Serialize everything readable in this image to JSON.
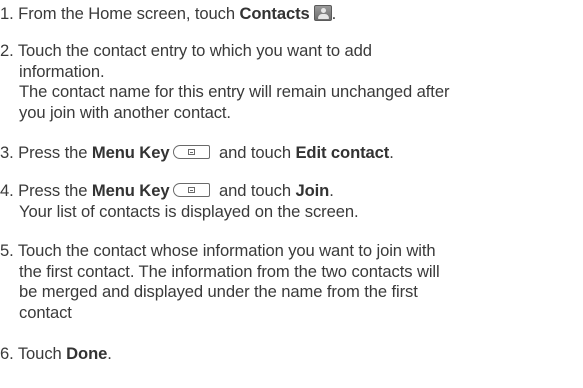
{
  "steps": [
    {
      "number": "1.",
      "line1_prefix": "From the Home screen, touch ",
      "line1_bold": "Contacts",
      "icon": "contacts-icon"
    },
    {
      "number": "2.",
      "line1": "Touch the contact entry to which you want to add",
      "line2": "information.",
      "line3": "The contact name for this entry will remain unchanged after",
      "line4": "you join with another contact."
    },
    {
      "number": "3.",
      "prefix": "Press the ",
      "bold1": "Menu Key",
      "icon": "menu-key-icon",
      "middle": " and touch ",
      "bold2": "Edit contact",
      "suffix": "."
    },
    {
      "number": "4.",
      "prefix": "Press the ",
      "bold1": "Menu Key",
      "icon": "menu-key-icon",
      "middle": " and touch ",
      "bold2": "Join",
      "suffix": ".",
      "line2": "Your list of contacts is displayed on the screen."
    },
    {
      "number": "5.",
      "line1": "Touch the contact whose information you want to join with",
      "line2": "the first contact. The information from the two contacts will",
      "line3": "be merged and displayed under the name from the first",
      "line4": "contact"
    },
    {
      "number": "6.",
      "prefix": "Touch ",
      "bold": "Done",
      "suffix": "."
    }
  ]
}
